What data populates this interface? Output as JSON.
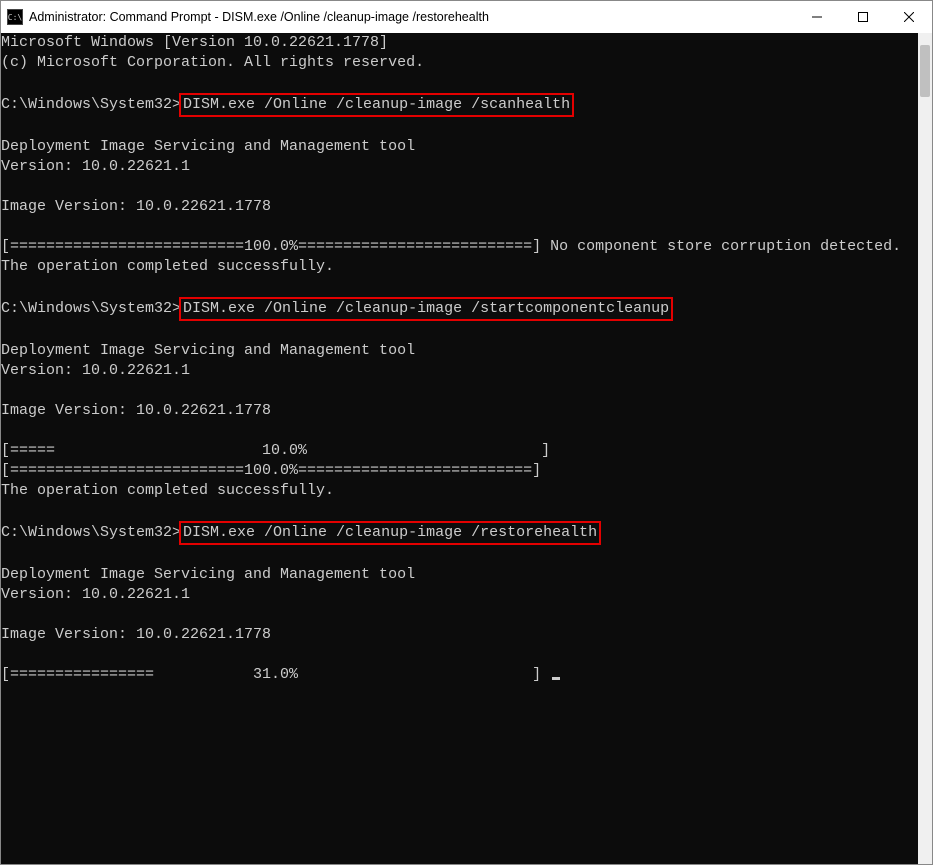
{
  "window": {
    "title": "Administrator: Command Prompt - DISM.exe  /Online /cleanup-image /restorehealth",
    "icon_label": "C:\\"
  },
  "terminal": {
    "header1": "Microsoft Windows [Version 10.0.22621.1778]",
    "header2": "(c) Microsoft Corporation. All rights reserved.",
    "prompt": "C:\\Windows\\System32>",
    "cmd1": "DISM.exe /Online /cleanup-image /scanhealth",
    "cmd2": "DISM.exe /Online /cleanup-image /startcomponentcleanup",
    "cmd3": "DISM.exe /Online /cleanup-image /restorehealth",
    "tool_name": "Deployment Image Servicing and Management tool",
    "tool_version_line": "Version: 10.0.22621.1",
    "image_version_line": "Image Version: 10.0.22621.1778",
    "progress1": "[==========================100.0%==========================] No component store corruption detected.",
    "op_success": "The operation completed successfully.",
    "progress2a": "[=====                       10.0%                          ]",
    "progress2b": "[==========================100.0%==========================]",
    "progress3": "[================           31.0%                          ] "
  },
  "controls": {
    "minimize": "minimize-icon",
    "maximize": "maximize-icon",
    "close": "close-icon"
  }
}
